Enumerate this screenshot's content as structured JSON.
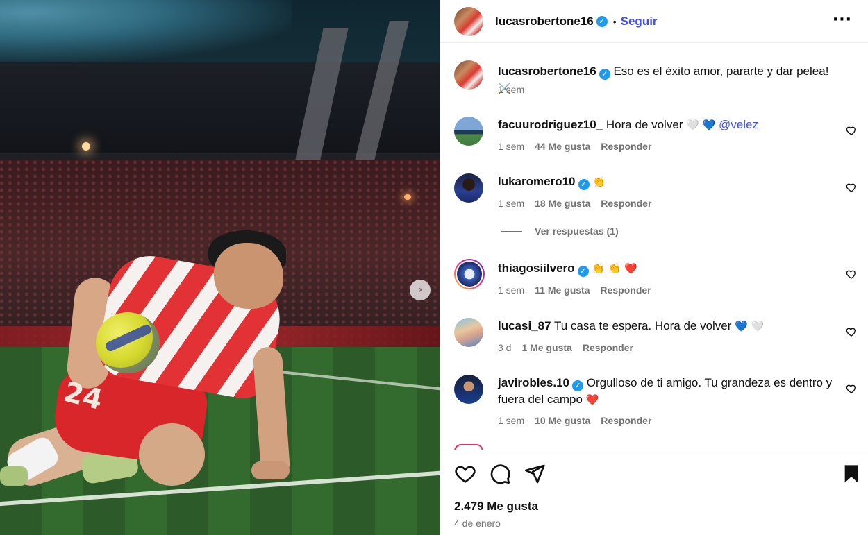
{
  "post": {
    "username": "lucasrobertone16",
    "follow_label": "Seguir",
    "caption": "Eso es el éxito amor, pararte y dar pelea!",
    "caption_emoji": "⚔️",
    "caption_time": "1 sem",
    "likes_total": "2.479 Me gusta",
    "date": "4 de enero",
    "dot": "•",
    "more_icon": "···"
  },
  "comments": [
    {
      "username": "facuurodriguez10_",
      "text": "Hora de volver",
      "emoji": "🤍 💙",
      "mention": "@velez",
      "time": "1 sem",
      "likes": "44 Me gusta",
      "reply": "Responder"
    },
    {
      "username": "lukaromero10",
      "text": "",
      "emoji": "👏",
      "time": "1 sem",
      "likes": "18 Me gusta",
      "reply": "Responder"
    },
    {
      "username": "thiagosiilvero",
      "text": "",
      "emoji": "👏 👏 ❤️",
      "time": "1 sem",
      "likes": "11 Me gusta",
      "reply": "Responder"
    },
    {
      "username": "lucasi_87",
      "text": "Tu casa te espera. Hora de volver",
      "emoji": "💙 🤍",
      "time": "3 d",
      "likes": "1 Me gusta",
      "reply": "Responder"
    },
    {
      "username": "javirobles.10",
      "text": "Orgulloso de ti amigo. Tu grandeza es dentro y fuera del campo",
      "emoji": "❤️",
      "time": "1 sem",
      "likes": "10 Me gusta",
      "reply": "Responder"
    }
  ],
  "view_replies": "Ver respuestas (1)",
  "photo": {
    "jersey_number": "24"
  },
  "colors": {
    "accent": "#4150f7",
    "verified": "#1d9bf0",
    "muted": "#737373"
  },
  "icons": [
    "more-options-icon",
    "verified-icon",
    "heart-icon",
    "comment-icon",
    "share-icon",
    "save-icon",
    "chevron-right-icon"
  ]
}
